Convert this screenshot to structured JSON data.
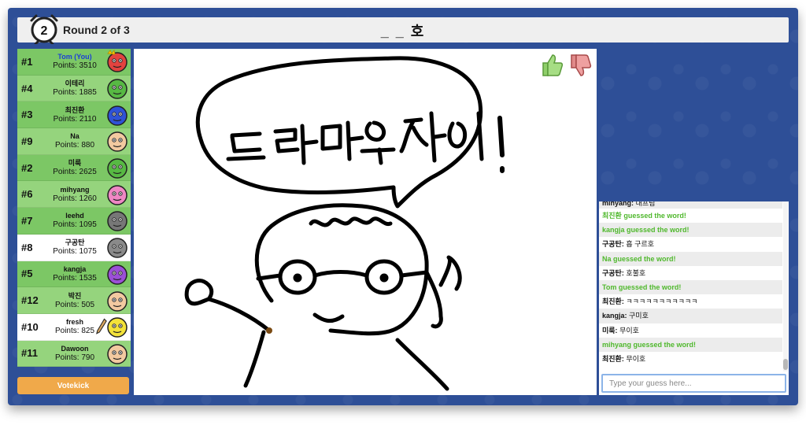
{
  "header": {
    "round_number": "2",
    "round_label": "Round 2 of 3",
    "word_hint": "_ _ 호"
  },
  "players": [
    {
      "rank": "#1",
      "name": "Tom (You)",
      "points": "Points: 3510",
      "is_you": true,
      "avatar_color": "#e2433f",
      "has_crown": true
    },
    {
      "rank": "#4",
      "name": "이테리",
      "points": "Points: 1885",
      "avatar_color": "#57b943"
    },
    {
      "rank": "#3",
      "name": "최진환",
      "points": "Points: 2110",
      "avatar_color": "#2f52d6"
    },
    {
      "rank": "#9",
      "name": "Na",
      "points": "Points: 880",
      "avatar_color": "#f2c9a0"
    },
    {
      "rank": "#2",
      "name": "미룩",
      "points": "Points: 2625",
      "avatar_color": "#57b943"
    },
    {
      "rank": "#6",
      "name": "mihyang",
      "points": "Points: 1260",
      "avatar_color": "#ef87c4"
    },
    {
      "rank": "#7",
      "name": "leehd",
      "points": "Points: 1095",
      "avatar_color": "#777777"
    },
    {
      "rank": "#8",
      "name": "구공탄",
      "points": "Points: 1075",
      "avatar_color": "#8a8a8a",
      "is_me_row": true
    },
    {
      "rank": "#5",
      "name": "kangja",
      "points": "Points: 1535",
      "avatar_color": "#9b4fd6"
    },
    {
      "rank": "#12",
      "name": "박진",
      "points": "Points: 505",
      "avatar_color": "#f2c9a0"
    },
    {
      "rank": "#10",
      "name": "fresh",
      "points": "Points: 825",
      "avatar_color": "#f3e23a",
      "is_drawing": true,
      "is_me_row": true
    },
    {
      "rank": "#11",
      "name": "Dawoon",
      "points": "Points: 790",
      "avatar_color": "#f2c9a0"
    }
  ],
  "votekick_label": "Votekick",
  "chat": {
    "messages": [
      {
        "author": "mihyang:",
        "text": "내프림",
        "type": "cut"
      },
      {
        "author": "최진환 guessed the word!",
        "text": "",
        "type": "guessed"
      },
      {
        "author": "kangja guessed the word!",
        "text": "",
        "type": "guessed"
      },
      {
        "author": "구공탄:",
        "text": "흡 구르호",
        "type": "normal"
      },
      {
        "author": "Na guessed the word!",
        "text": "",
        "type": "guessed"
      },
      {
        "author": "구공탄:",
        "text": "호불호",
        "type": "normal"
      },
      {
        "author": "Tom guessed the word!",
        "text": "",
        "type": "guessed"
      },
      {
        "author": "최진환:",
        "text": "ㅋㅋㅋㅋㅋㅋㅋㅋㅋㅋㅋ",
        "type": "normal"
      },
      {
        "author": "kangja:",
        "text": "구미호",
        "type": "normal"
      },
      {
        "author": "미룩:",
        "text": "무이호",
        "type": "normal"
      },
      {
        "author": "mihyang guessed the word!",
        "text": "",
        "type": "guessed"
      },
      {
        "author": "최진환:",
        "text": "무이호",
        "type": "normal"
      }
    ],
    "input_placeholder": "Type your guess here..."
  },
  "drawing": {
    "bubble_text": "드라마 우쿠이 !"
  },
  "colors": {
    "frame": "#2e4f97",
    "row_odd": "#7cc765",
    "row_even": "#95d47d",
    "guessed": "#4fb82c",
    "votekick": "#f0a94a"
  }
}
